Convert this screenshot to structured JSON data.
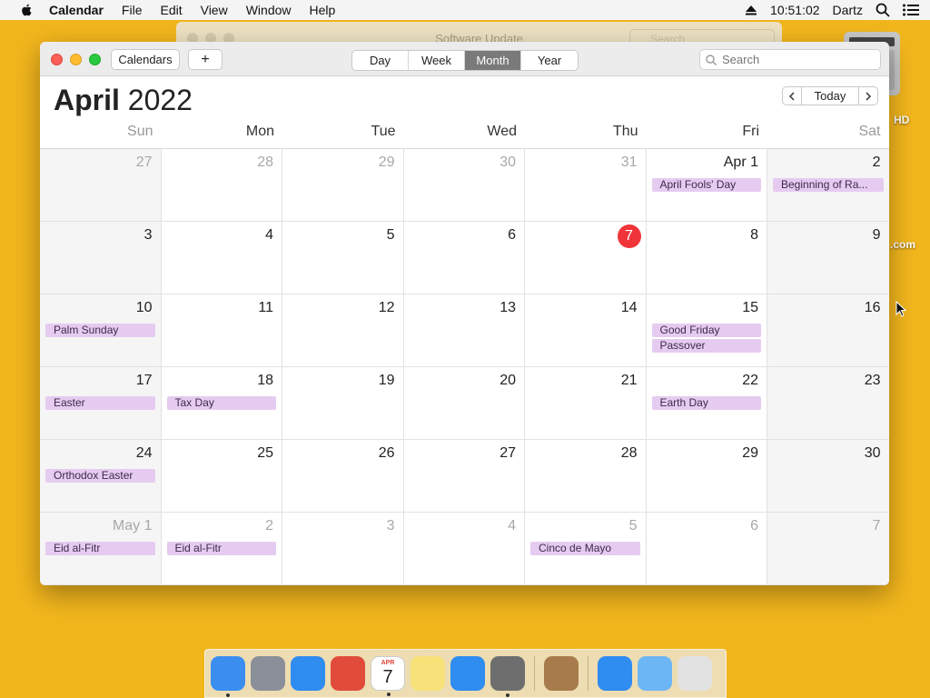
{
  "menubar": {
    "app_name": "Calendar",
    "items": [
      "File",
      "Edit",
      "View",
      "Window",
      "Help"
    ],
    "clock": "10:51:02",
    "user": "Dartz"
  },
  "background_window": {
    "title": "Software Update",
    "search_placeholder": "Search"
  },
  "desktop": {
    "labels": [
      "HD",
      ".com"
    ]
  },
  "toolbar": {
    "calendars_label": "Calendars",
    "add_label": "+",
    "views": [
      "Day",
      "Week",
      "Month",
      "Year"
    ],
    "active_view": "Month",
    "search_placeholder": "Search"
  },
  "header": {
    "month": "April",
    "year": "2022",
    "today_label": "Today",
    "prev_label": "‹",
    "next_label": "›"
  },
  "weekdays": [
    "Sun",
    "Mon",
    "Tue",
    "Wed",
    "Thu",
    "Fri",
    "Sat"
  ],
  "weeks": [
    [
      {
        "day": "27",
        "dim": true,
        "events": []
      },
      {
        "day": "28",
        "dim": true,
        "events": []
      },
      {
        "day": "29",
        "dim": true,
        "events": []
      },
      {
        "day": "30",
        "dim": true,
        "events": []
      },
      {
        "day": "31",
        "dim": true,
        "events": []
      },
      {
        "day": "Apr 1",
        "dim": false,
        "events": [
          "April Fools' Day"
        ]
      },
      {
        "day": "2",
        "dim": false,
        "events": [
          "Beginning of Ra..."
        ]
      }
    ],
    [
      {
        "day": "3",
        "events": []
      },
      {
        "day": "4",
        "events": []
      },
      {
        "day": "5",
        "events": []
      },
      {
        "day": "6",
        "events": []
      },
      {
        "day": "7",
        "today": true,
        "events": []
      },
      {
        "day": "8",
        "events": []
      },
      {
        "day": "9",
        "events": []
      }
    ],
    [
      {
        "day": "10",
        "events": [
          "Palm Sunday"
        ]
      },
      {
        "day": "11",
        "events": []
      },
      {
        "day": "12",
        "events": []
      },
      {
        "day": "13",
        "events": []
      },
      {
        "day": "14",
        "events": []
      },
      {
        "day": "15",
        "events": [
          "Good Friday",
          "Passover"
        ]
      },
      {
        "day": "16",
        "events": []
      }
    ],
    [
      {
        "day": "17",
        "events": [
          "Easter"
        ]
      },
      {
        "day": "18",
        "events": [
          "Tax Day"
        ]
      },
      {
        "day": "19",
        "events": []
      },
      {
        "day": "20",
        "events": []
      },
      {
        "day": "21",
        "events": []
      },
      {
        "day": "22",
        "events": [
          "Earth Day"
        ]
      },
      {
        "day": "23",
        "events": []
      }
    ],
    [
      {
        "day": "24",
        "events": [
          "Orthodox Easter"
        ]
      },
      {
        "day": "25",
        "events": []
      },
      {
        "day": "26",
        "events": []
      },
      {
        "day": "27",
        "events": []
      },
      {
        "day": "28",
        "events": []
      },
      {
        "day": "29",
        "events": []
      },
      {
        "day": "30",
        "events": []
      }
    ],
    [
      {
        "day": "May 1",
        "dim": true,
        "events": [
          "Eid al-Fitr"
        ]
      },
      {
        "day": "2",
        "dim": true,
        "events": [
          "Eid al-Fitr"
        ]
      },
      {
        "day": "3",
        "dim": true,
        "events": []
      },
      {
        "day": "4",
        "dim": true,
        "events": []
      },
      {
        "day": "5",
        "dim": true,
        "events": [
          "Cinco de Mayo"
        ]
      },
      {
        "day": "6",
        "dim": true,
        "events": []
      },
      {
        "day": "7",
        "dim": true,
        "events": []
      }
    ]
  ],
  "dock": {
    "items": [
      {
        "name": "finder-icon",
        "color": "#3b8ef0",
        "running": true
      },
      {
        "name": "launchpad-icon",
        "color": "#8a8f99",
        "running": false
      },
      {
        "name": "safari-icon",
        "color": "#2f8cf0",
        "running": false
      },
      {
        "name": "chrome-icon",
        "color": "#e04b3a",
        "running": false
      },
      {
        "name": "calendar-icon",
        "color": "#ffffff",
        "running": true,
        "label": "7",
        "sub": "APR"
      },
      {
        "name": "notes-icon",
        "color": "#f7e27a",
        "running": false
      },
      {
        "name": "app-store-icon",
        "color": "#2f8cf0",
        "running": false
      },
      {
        "name": "system-preferences-icon",
        "color": "#6e6e6e",
        "running": true
      },
      {
        "name": "sep"
      },
      {
        "name": "contacts-icon",
        "color": "#a77b4c",
        "running": false
      },
      {
        "name": "sep"
      },
      {
        "name": "app-store-folder-icon",
        "color": "#2f8cf0",
        "running": false
      },
      {
        "name": "downloads-folder-icon",
        "color": "#6cb6f5",
        "running": false
      },
      {
        "name": "trash-icon",
        "color": "#e2e2e2",
        "running": false
      }
    ]
  }
}
